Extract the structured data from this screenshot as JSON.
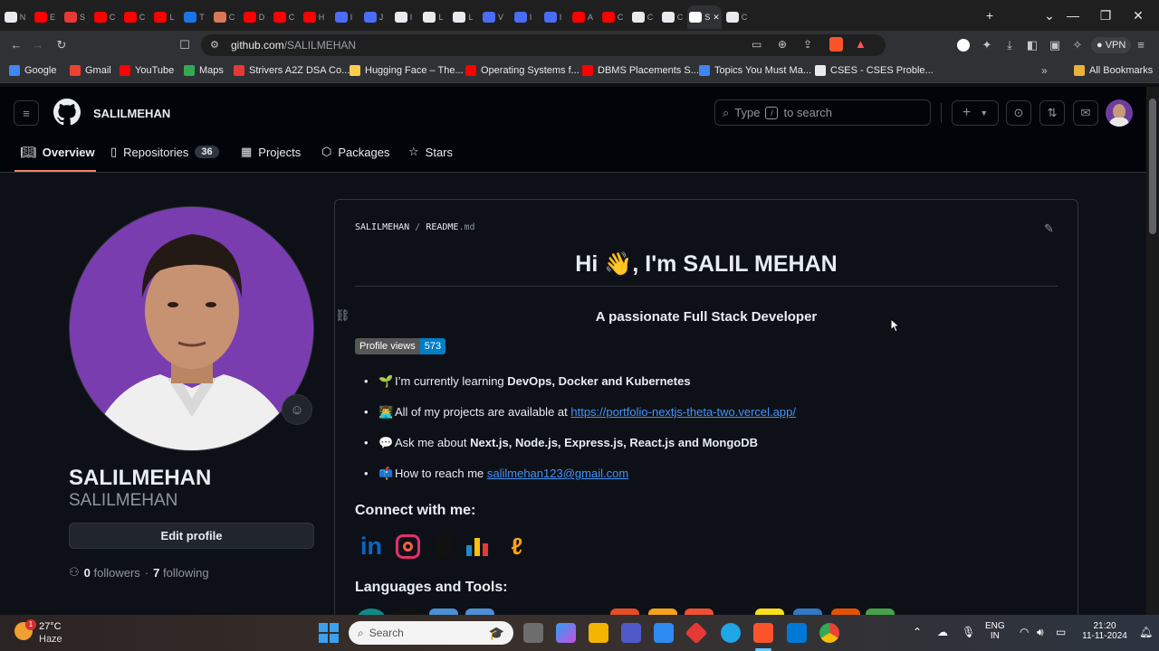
{
  "browser": {
    "tabs": [
      {
        "letter": "N",
        "color": "#e8eaed"
      },
      {
        "letter": "E",
        "color": "#ff0000"
      },
      {
        "letter": "S",
        "color": "#e53935"
      },
      {
        "letter": "C",
        "color": "#ff0000"
      },
      {
        "letter": "C",
        "color": "#ff0000"
      },
      {
        "letter": "L",
        "color": "#ff0000"
      },
      {
        "letter": "T",
        "color": "#1a73e8"
      },
      {
        "letter": "C",
        "color": "#d97757"
      },
      {
        "letter": "D",
        "color": "#ff0000"
      },
      {
        "letter": "C",
        "color": "#ff0000"
      },
      {
        "letter": "H",
        "color": "#ff0000"
      },
      {
        "letter": "I",
        "color": "#4a6cf7"
      },
      {
        "letter": "J",
        "color": "#4a6cf7"
      },
      {
        "letter": "I",
        "color": "#e8eaed"
      },
      {
        "letter": "L",
        "color": "#e8eaed"
      },
      {
        "letter": "L",
        "color": "#e8eaed"
      },
      {
        "letter": "V",
        "color": "#4a6cf7"
      },
      {
        "letter": "I",
        "color": "#4a6cf7"
      },
      {
        "letter": "I",
        "color": "#4a6cf7"
      },
      {
        "letter": "A",
        "color": "#ff0000"
      },
      {
        "letter": "C",
        "color": "#ff0000"
      },
      {
        "letter": "C",
        "color": "#e8eaed"
      },
      {
        "letter": "C",
        "color": "#e8eaed"
      },
      {
        "letter": "S",
        "color": "#ffffff",
        "active": true
      },
      {
        "letter": "C",
        "color": "#e8eaed"
      }
    ],
    "url_host": "github.com",
    "url_path": "/SALILMEHAN",
    "vpn_label": "VPN",
    "bookmarks": [
      {
        "label": "Google",
        "color": "#4285f4"
      },
      {
        "label": "Gmail",
        "color": "#ea4335"
      },
      {
        "label": "YouTube",
        "color": "#ff0000"
      },
      {
        "label": "Maps",
        "color": "#34a853"
      },
      {
        "label": "Strivers A2Z DSA Co...",
        "color": "#e53935"
      },
      {
        "label": "Hugging Face – The...",
        "color": "#ffcc4d"
      },
      {
        "label": "Operating Systems f...",
        "color": "#ff0000"
      },
      {
        "label": "DBMS Placements S...",
        "color": "#ff0000"
      },
      {
        "label": "Topics You Must Ma...",
        "color": "#4285f4"
      },
      {
        "label": "CSES - CSES Proble...",
        "color": "#e8eaed"
      }
    ],
    "all_bookmarks": "All Bookmarks"
  },
  "github": {
    "username": "SALILMEHAN",
    "search_prefix": "Type",
    "search_key": "/",
    "search_suffix": "to search",
    "nav": {
      "overview": "Overview",
      "repositories": "Repositories",
      "repo_count": "36",
      "projects": "Projects",
      "packages": "Packages",
      "stars": "Stars"
    },
    "profile": {
      "name": "SALILMEHAN",
      "login": "SALILMEHAN",
      "edit_button": "Edit profile",
      "followers_count": "0",
      "followers_label": "followers",
      "separator": "·",
      "following_count": "7",
      "following_label": "following"
    },
    "readme": {
      "path_owner": "SALILMEHAN",
      "path_sep": "/",
      "path_file": "README",
      "path_ext": ".md",
      "heading": "Hi 👋, I'm SALIL MEHAN",
      "subheading": "A passionate Full Stack Developer",
      "badge_label": "Profile views",
      "badge_value": "573",
      "bullets": [
        {
          "emoji": "🌱",
          "text": "I’m currently learning ",
          "bold": "DevOps, Docker and Kubernetes"
        },
        {
          "emoji": "👨‍💻",
          "text": "All of my projects are available at ",
          "link": "https://portfolio-nextjs-theta-two.vercel.app/"
        },
        {
          "emoji": "💬",
          "text": "Ask me about ",
          "bold": "Next.js, Node.js, Express.js, React.js and MongoDB"
        },
        {
          "emoji": "📫",
          "text": "How to reach me ",
          "link": "salilmehan123@gmail.com"
        }
      ],
      "connect_heading": "Connect with me:",
      "tools_heading": "Languages and Tools:"
    }
  },
  "taskbar": {
    "temperature": "27°C",
    "weather": "Haze",
    "weather_badge": "1",
    "search_placeholder": "Search",
    "lang": "ENG",
    "region": "IN",
    "time": "21:20",
    "date": "11-11-2024"
  }
}
